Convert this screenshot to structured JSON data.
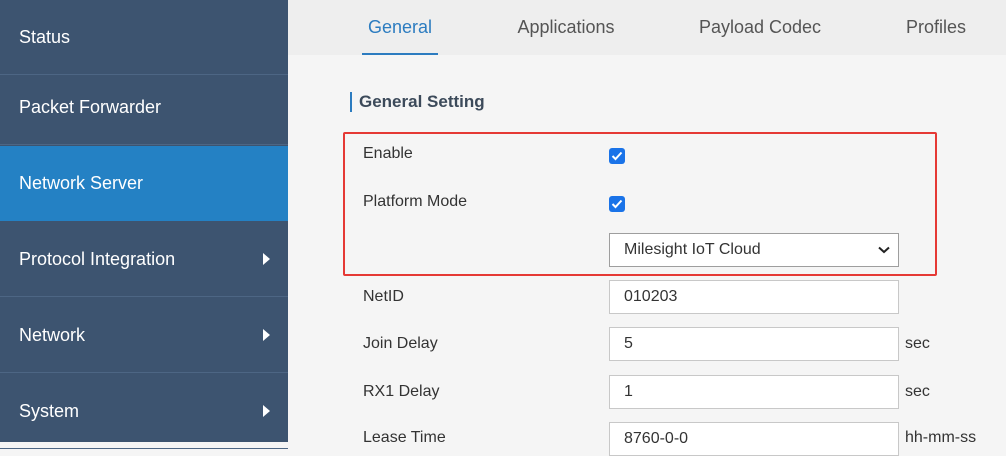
{
  "sidebar": {
    "items": [
      {
        "label": "Status"
      },
      {
        "label": "Packet Forwarder"
      },
      {
        "label": "Network Server"
      },
      {
        "label": "Protocol Integration"
      },
      {
        "label": "Network"
      },
      {
        "label": "System"
      }
    ]
  },
  "tabs": [
    {
      "label": "General"
    },
    {
      "label": "Applications"
    },
    {
      "label": "Payload Codec"
    },
    {
      "label": "Profiles"
    }
  ],
  "section": {
    "title": "General Setting"
  },
  "form": {
    "enable": {
      "label": "Enable",
      "checked": true
    },
    "platform_mode": {
      "label": "Platform Mode",
      "checked": true,
      "selected": "Milesight IoT Cloud"
    },
    "netid": {
      "label": "NetID",
      "value": "010203"
    },
    "join_delay": {
      "label": "Join Delay",
      "value": "5",
      "unit": "sec"
    },
    "rx1_delay": {
      "label": "RX1 Delay",
      "value": "1",
      "unit": "sec"
    },
    "lease_time": {
      "label": "Lease Time",
      "value": "8760-0-0",
      "unit": "hh-mm-ss"
    }
  },
  "colors": {
    "sidebar_bg": "#3d5470",
    "sidebar_active": "#2481c4",
    "accent": "#2c7cc0",
    "highlight_border": "#e53935",
    "checkbox": "#1a73e8"
  }
}
